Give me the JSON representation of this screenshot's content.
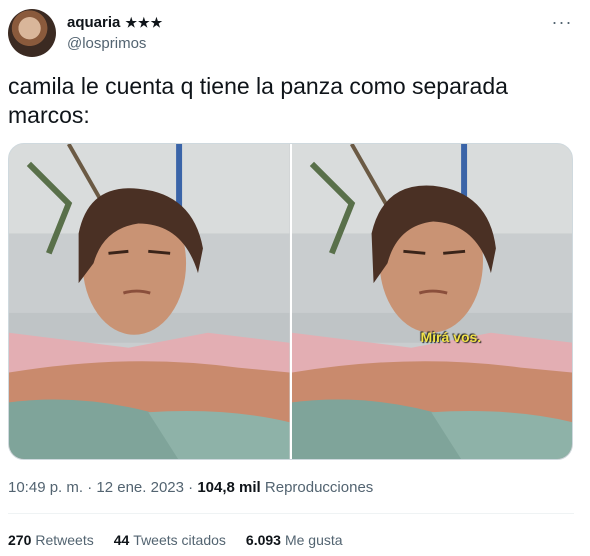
{
  "author": {
    "display_name": "aquaria",
    "badge": "★★★",
    "handle": "@losprimos"
  },
  "tweet": {
    "text_line1": "camila le cuenta q tiene la panza como separada",
    "text_line2": "marcos:"
  },
  "media": {
    "frame2_subtitle": "Mirá vos."
  },
  "meta": {
    "time": "10:49 p. m.",
    "separator": "·",
    "date": "12 ene. 2023",
    "views_count": "104,8 mil",
    "views_label": "Reproducciones"
  },
  "stats": {
    "retweets_count": "270",
    "retweets_label": "Retweets",
    "quotes_count": "44",
    "quotes_label": "Tweets citados",
    "likes_count": "6.093",
    "likes_label": "Me gusta"
  },
  "icons": {
    "more": "more-dots-icon"
  }
}
